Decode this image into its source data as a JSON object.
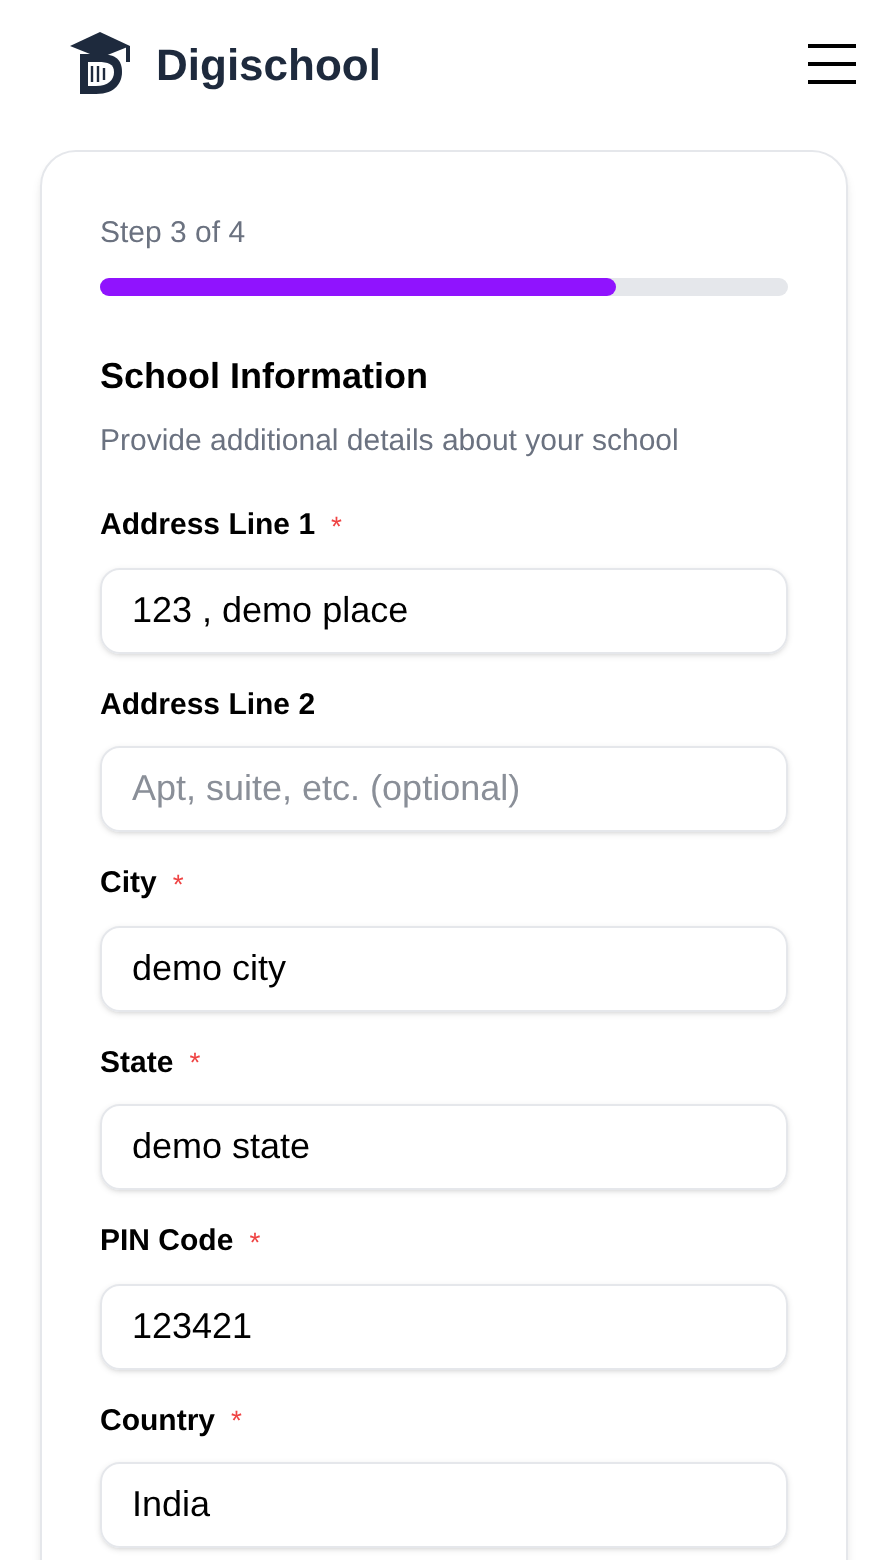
{
  "header": {
    "brand": "Digischool"
  },
  "form": {
    "step": "Step 3 of 4",
    "progress": {
      "level": 0.75
    },
    "title": "School Information",
    "subtitle": "Provide additional details about your school",
    "fields": [
      {
        "label": "Address Line 1",
        "required_mark": "*",
        "value": "123 , demo place"
      },
      {
        "label": "Address Line 2",
        "placeholder": "Apt, suite, etc. (optional)"
      },
      {
        "label": "City",
        "required_mark": "*",
        "value": "demo city"
      },
      {
        "label": "State",
        "required_mark": "*",
        "value": "demo state"
      },
      {
        "label": "PIN Code",
        "required_mark": "*",
        "value": "123421"
      },
      {
        "label": "Country",
        "required_mark": "*",
        "value": "India"
      }
    ]
  }
}
